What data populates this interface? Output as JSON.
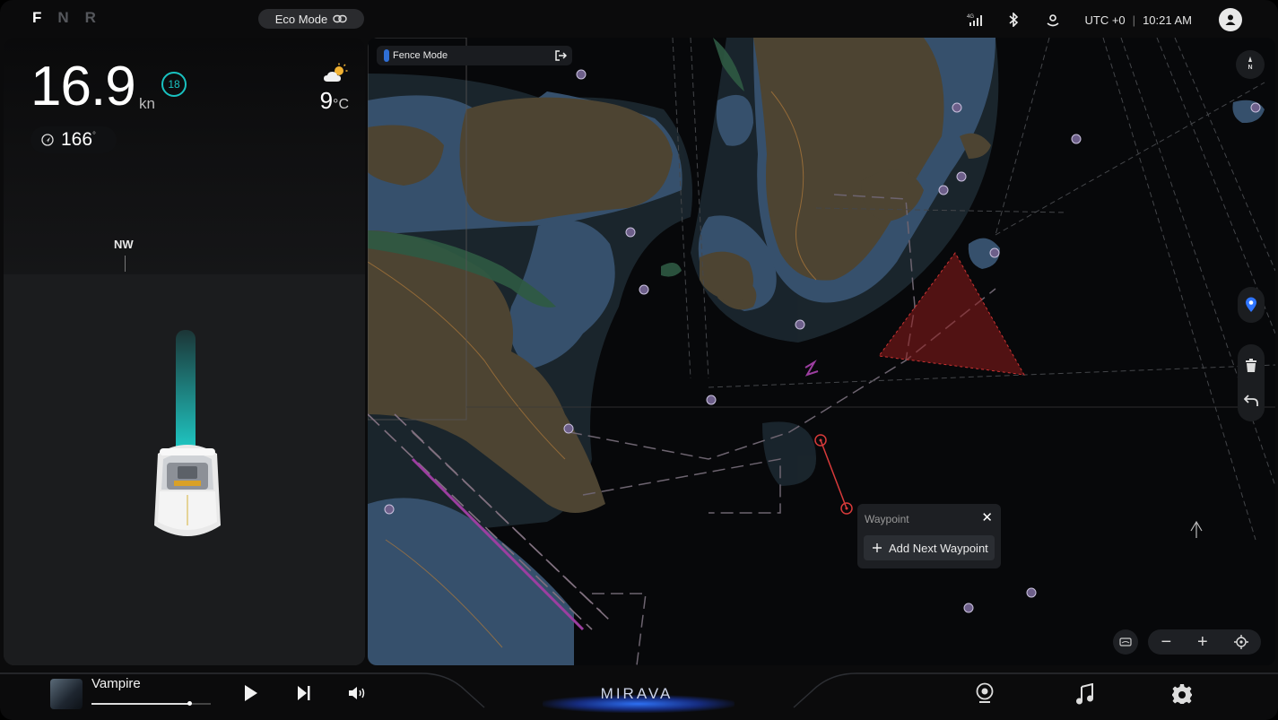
{
  "gears": {
    "items": [
      "F",
      "N",
      "R"
    ],
    "active": "F"
  },
  "eco_mode": {
    "label": "Eco Mode"
  },
  "status": {
    "network": "4G",
    "timezone": "UTC +0",
    "separator": "|",
    "time": "10:21 AM"
  },
  "dashboard": {
    "speed": "16.9",
    "speed_unit": "kn",
    "speed_limit": "18",
    "heading": "166",
    "heading_unit": "°",
    "temperature": "9",
    "temperature_unit": "°C",
    "weather_icon": "partly-cloudy-icon",
    "compass_label": "NW"
  },
  "map": {
    "fence_mode_label": "Fence Mode",
    "waypoint_popup": {
      "title": "Waypoint",
      "close": "✕",
      "add_button": "Add Next Waypoint"
    },
    "north_label": "N",
    "zoom": {
      "minus": "−",
      "plus": "+"
    }
  },
  "media": {
    "track": "Vampire",
    "progress": 0.82
  },
  "brand": {
    "name": "MIRAVA"
  },
  "colors": {
    "accent_teal": "#1fc6c2",
    "accent_blue": "#2f75ff",
    "danger_red": "#8e1b1b",
    "land": "#4d4432",
    "shallow": "#36506c"
  }
}
